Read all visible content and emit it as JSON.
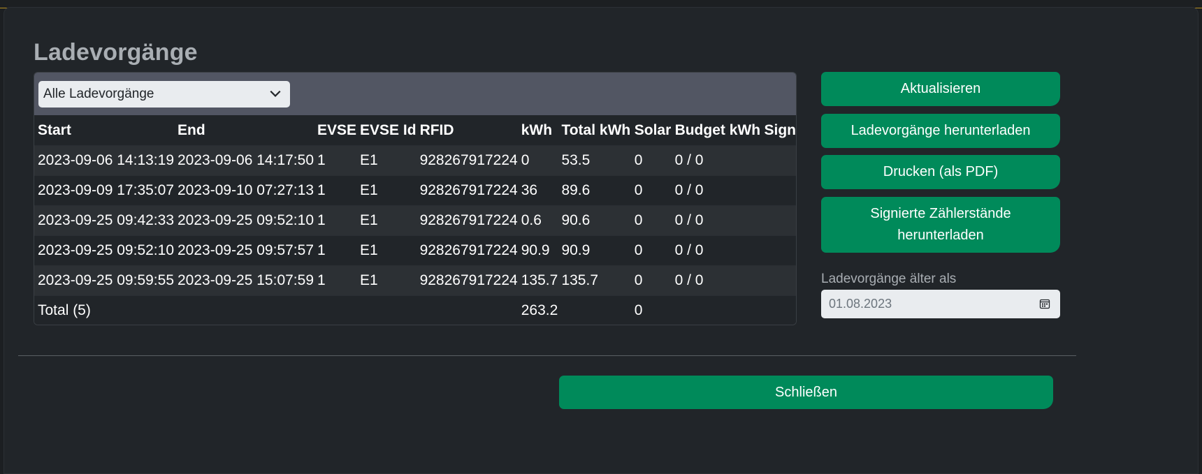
{
  "modal": {
    "title": "Ladevorgänge"
  },
  "filter": {
    "selected": "Alle Ladevorgänge"
  },
  "table": {
    "columns": [
      "Start",
      "End",
      "EVSE",
      "EVSE Id",
      "RFID",
      "kWh",
      "Total kWh",
      "Solar",
      "Budget kWh",
      "Sign"
    ],
    "rows": [
      [
        "2023-09-06 14:13:19",
        "2023-09-06 14:17:50",
        "1",
        "E1",
        "928267917224",
        "0",
        "53.5",
        "0",
        "0 / 0",
        ""
      ],
      [
        "2023-09-09 17:35:07",
        "2023-09-10 07:27:13",
        "1",
        "E1",
        "928267917224",
        "36",
        "89.6",
        "0",
        "0 / 0",
        ""
      ],
      [
        "2023-09-25 09:42:33",
        "2023-09-25 09:52:10",
        "1",
        "E1",
        "928267917224",
        "0.6",
        "90.6",
        "0",
        "0 / 0",
        ""
      ],
      [
        "2023-09-25 09:52:10",
        "2023-09-25 09:57:57",
        "1",
        "E1",
        "928267917224",
        "90.9",
        "90.9",
        "0",
        "0 / 0",
        ""
      ],
      [
        "2023-09-25 09:59:55",
        "2023-09-25 15:07:59",
        "1",
        "E1",
        "928267917224",
        "135.7",
        "135.7",
        "0",
        "0 / 0",
        ""
      ]
    ],
    "footer": {
      "label": "Total (5)",
      "kwh": "263.2",
      "solar": "0"
    }
  },
  "actions": {
    "refresh": "Aktualisieren",
    "download": "Ladevorgänge herunterladen",
    "print": "Drucken (als PDF)",
    "signed_line1": "Signierte Zählerstände",
    "signed_line2": "herunterladen"
  },
  "older_than": {
    "label": "Ladevorgänge älter als",
    "value": "01.08.2023"
  },
  "footer": {
    "close": "Schließen"
  },
  "colors": {
    "accent": "#008a5a",
    "background": "#212529",
    "filter_bar": "#525663"
  }
}
